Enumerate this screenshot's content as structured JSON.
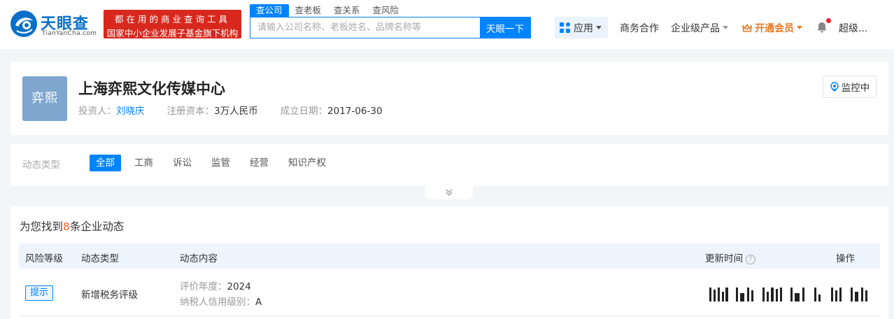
{
  "brand": {
    "name_cn": "天眼查",
    "name_en": "TianYanCha.com",
    "slogan_line1": "都在用的商业查询工具",
    "slogan_line2": "国家中小企业发展子基金旗下机构",
    "color": "#0b6fc9"
  },
  "search": {
    "tabs": [
      "查公司",
      "查老板",
      "查关系",
      "查风险"
    ],
    "active_tab": 0,
    "placeholder": "请输入公司名称、老板姓名、品牌名称等",
    "value": "",
    "button_label": "天眼一下"
  },
  "nav": {
    "apps_label": "应用",
    "business_label": "商务合作",
    "enterprise_label": "企业级产品",
    "vip_label": "开通会员",
    "user_label": "超级..."
  },
  "company": {
    "avatar_text": "弈熙",
    "name": "上海弈熙文化传媒中心",
    "investor_label": "投资人：",
    "investor": "刘晓庆",
    "capital_label": "注册资本：",
    "capital": "3万人民币",
    "founded_label": "成立日期：",
    "founded": "2017-06-30",
    "monitor_label": "监控中"
  },
  "filter": {
    "label": "动态类型",
    "tabs": [
      "全部",
      "工商",
      "诉讼",
      "监管",
      "经营",
      "知识产权"
    ],
    "active_tab": 0
  },
  "results": {
    "title_prefix": "为您找到",
    "count": "8",
    "title_suffix": "条企业动态",
    "columns": {
      "risk": "风险等级",
      "type": "动态类型",
      "content": "动态内容",
      "time": "更新时间",
      "action": "操作"
    },
    "rows": [
      {
        "risk": "提示",
        "type": "新增税务评级",
        "content": [
          {
            "key": "评价年度：",
            "value": "2024"
          },
          {
            "key": "纳税人信用级别：",
            "value": "A"
          }
        ]
      }
    ]
  },
  "colors": {
    "primary": "#0084ff",
    "accent_red": "#d8281e",
    "vip_orange": "#e87722",
    "count_orange": "#f5602d"
  }
}
